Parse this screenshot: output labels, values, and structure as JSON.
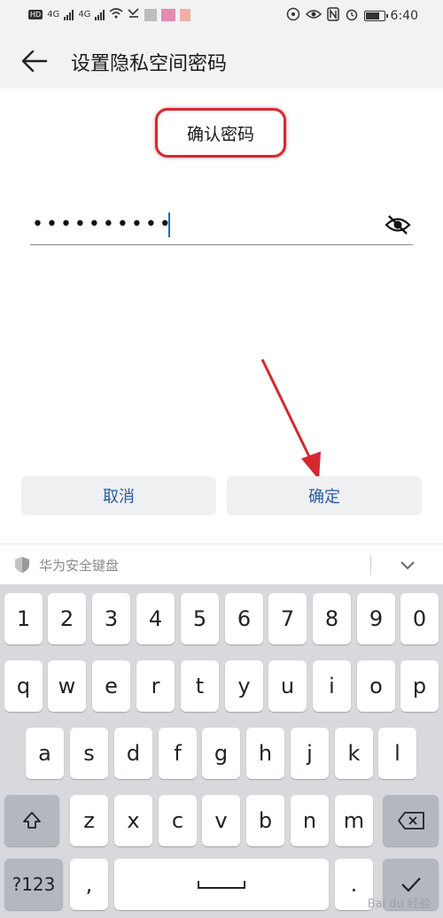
{
  "status_bar": {
    "left_badges": [
      "HD",
      "4G",
      "4G"
    ],
    "time": "6:40",
    "battery_level": 0.8
  },
  "header": {
    "title": "设置隐私空间密码",
    "back_icon": "back-arrow-icon"
  },
  "form": {
    "label": "确认密码",
    "password_masked": "••••••••••",
    "visibility_icon": "eye-off-icon"
  },
  "buttons": {
    "cancel": "取消",
    "confirm": "确定"
  },
  "keyboard": {
    "title": "华为安全键盘",
    "row_numbers": [
      "1",
      "2",
      "3",
      "4",
      "5",
      "6",
      "7",
      "8",
      "9",
      "0"
    ],
    "row_top": [
      "q",
      "w",
      "e",
      "r",
      "t",
      "y",
      "u",
      "i",
      "o",
      "p"
    ],
    "row_mid": [
      "a",
      "s",
      "d",
      "f",
      "g",
      "h",
      "j",
      "k",
      "l"
    ],
    "row_bottom": [
      "z",
      "x",
      "c",
      "v",
      "b",
      "n",
      "m"
    ],
    "symbols_key": "?123",
    "comma_key": ",",
    "period_key": ".",
    "watermark": "Bai du 经验"
  },
  "colors": {
    "annotation_red": "#d7282f",
    "button_text_blue": "#2c5aa8"
  }
}
